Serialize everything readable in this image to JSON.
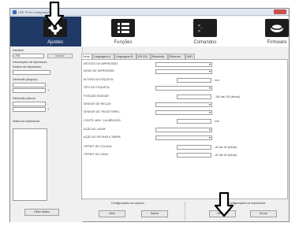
{
  "window": {
    "title": "LBE Print Configurações"
  },
  "nav": {
    "items": [
      {
        "label": "Ajustes",
        "icon": "gear-icon",
        "active": true
      },
      {
        "label": "Funções",
        "icon": "list-icon",
        "active": false
      },
      {
        "label": "Comandos",
        "icon": "terminal-icon",
        "active": false
      },
      {
        "label": "Firmware",
        "icon": "chip-icon",
        "active": false
      }
    ]
  },
  "left_panel": {
    "interface_label": "Interface",
    "interface_value": "USB",
    "search_button": "Buscar",
    "printer_info_label": "Informações da impressora",
    "printer_model_label": "Modelo da impressora:",
    "label_width_label": "Dimensão (largura):",
    "label_height_label": "Dimensão (altura):",
    "printer_status_label": "Status da impressora",
    "status_button": "Obter Status",
    "minus_sign": "-",
    "plus_sign": "+"
  },
  "tabs": [
    {
      "label": "Geral",
      "active": true
    },
    {
      "label": "Linguagem A",
      "active": false
    },
    {
      "label": "Linguagem B",
      "active": false
    },
    {
      "label": "RS-232",
      "active": false
    },
    {
      "label": "Bluetooth",
      "active": false
    },
    {
      "label": "Ethernet",
      "active": false
    },
    {
      "label": "WiFi",
      "active": false
    }
  ],
  "settings": {
    "rows": [
      {
        "label": "MÉTODO DE IMPRESSÃO:",
        "control": "select"
      },
      {
        "label": "MODO DE IMPRESSÃO:",
        "control": "select"
      },
      {
        "label": "ALTURA DA ETIQUETA:",
        "control": "input",
        "unit": "mm"
      },
      {
        "label": "TIPO DE ETIQUETA:",
        "control": "select"
      },
      {
        "label": "POSIÇÃO RASGAR:",
        "control": "input",
        "unit": "-100 até 100 (linhas)"
      },
      {
        "label": "SENSOR DE RECUO:",
        "control": "select"
      },
      {
        "label": "SENSOR DE FIM DE PAPEL:",
        "control": "select"
      },
      {
        "label": "CONTR. MÁX. CALIBRAÇÃO:",
        "control": "input",
        "unit": "mm"
      },
      {
        "label": "AÇÃO AO LIGAR:",
        "control": "select"
      },
      {
        "label": "AÇÃO AO FECHAR A TAMPA:",
        "control": "select"
      },
      {
        "label": "OFFSET DE COLUNA:",
        "control": "input",
        "unit": "-60 até 60 (linhas)"
      },
      {
        "label": "OFFSET DE LINHA:",
        "control": "input",
        "unit": "-60 até 60 (linhas)"
      }
    ]
  },
  "bottom": {
    "file_config_label": "Configurações em arquivo",
    "printer_config_label": "Configurações na impressora",
    "open_button": "Abrir",
    "save_button": "Salvar",
    "receive_button": "Receber",
    "send_button": "Enviar"
  },
  "colors": {
    "nav_active": "#1f3a66",
    "icon_bg": "#1d1d1d",
    "annotation_arrow": "#000000"
  }
}
